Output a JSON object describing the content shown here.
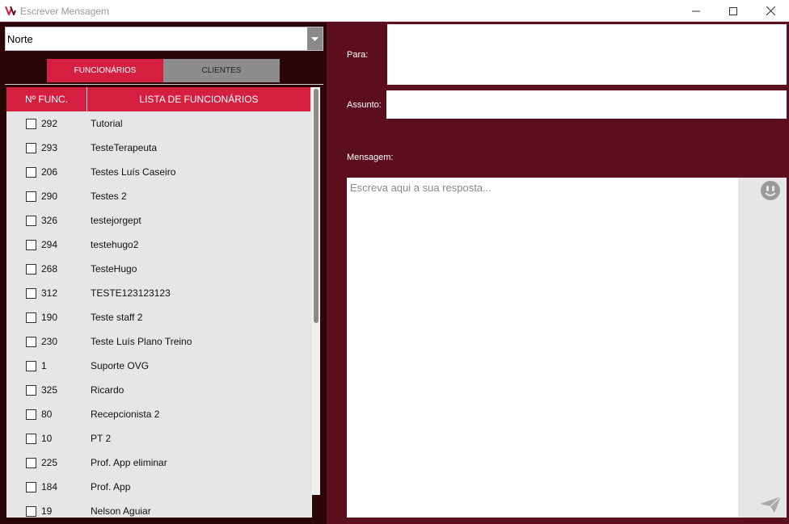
{
  "window": {
    "title": "Escrever Mensagem",
    "minimize": "—",
    "maximize": "☐",
    "close": "✕"
  },
  "recipients": {
    "region_value": "Norte",
    "tabs": [
      {
        "label": "FUNCIONÁRIOS",
        "active": true
      },
      {
        "label": "CLIENTES",
        "active": false
      }
    ],
    "columns": {
      "number": "Nº FUNC.",
      "name": "LISTA DE FUNCIONÁRIOS"
    },
    "rows": [
      {
        "num": "292",
        "name": "Tutorial"
      },
      {
        "num": "293",
        "name": "TesteTerapeuta"
      },
      {
        "num": "206",
        "name": "Testes Luís Caseiro"
      },
      {
        "num": "290",
        "name": "Testes 2"
      },
      {
        "num": "326",
        "name": "testejorgept"
      },
      {
        "num": "294",
        "name": "testehugo2"
      },
      {
        "num": "268",
        "name": "TesteHugo"
      },
      {
        "num": "312",
        "name": "TESTE123123123"
      },
      {
        "num": "190",
        "name": "Teste staff 2"
      },
      {
        "num": "230",
        "name": "Teste Luís Plano Treino"
      },
      {
        "num": "1",
        "name": "Suporte OVG"
      },
      {
        "num": "325",
        "name": "Ricardo"
      },
      {
        "num": "80",
        "name": "Recepcionista 2"
      },
      {
        "num": "10",
        "name": "PT 2"
      },
      {
        "num": "225",
        "name": "Prof. App eliminar"
      },
      {
        "num": "184",
        "name": "Prof. App"
      },
      {
        "num": "19",
        "name": "Nelson Aguiar"
      }
    ]
  },
  "compose": {
    "to_label": "Para:",
    "subject_label": "Assunto:",
    "message_label": "Mensagem:",
    "message_placeholder": "Escreva aqui a sua resposta..."
  },
  "colors": {
    "accent": "#d41f40",
    "background": "#5a0e1e",
    "panel": "#2a0608"
  }
}
